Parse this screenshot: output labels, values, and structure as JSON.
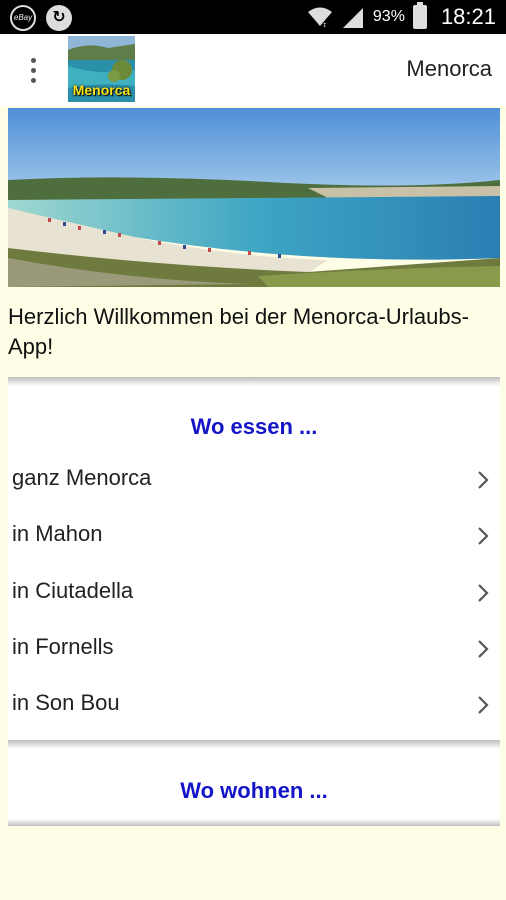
{
  "status_bar": {
    "ebay_icon_text": "eBay",
    "battery": "93%",
    "time": "18:21"
  },
  "app_bar": {
    "logo_text": "Menorca",
    "title": "Menorca"
  },
  "welcome_text": "Herzlich Willkommen bei der Menorca-Urlaubs-App!",
  "card_eat": {
    "heading": "Wo essen ...",
    "items": [
      {
        "label": "ganz Menorca"
      },
      {
        "label": "in Mahon"
      },
      {
        "label": "in Ciutadella"
      },
      {
        "label": "in Fornells"
      },
      {
        "label": "in Son Bou"
      }
    ]
  },
  "card_stay": {
    "heading": "Wo wohnen ..."
  },
  "colors": {
    "background": "#fefee6",
    "heading_blue": "#1515c8",
    "logo_yellow": "#f7e31a"
  }
}
